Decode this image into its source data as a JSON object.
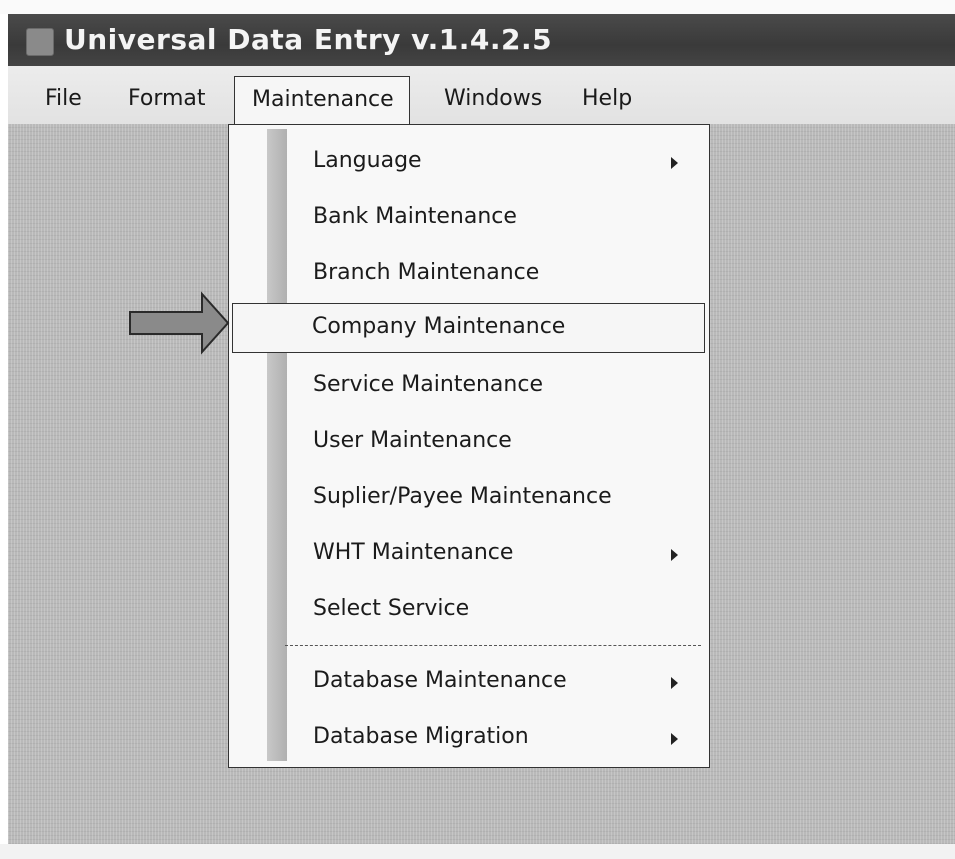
{
  "window": {
    "title": "Universal Data Entry v.1.4.2.5"
  },
  "menubar": {
    "items": [
      {
        "label": "File"
      },
      {
        "label": "Format"
      },
      {
        "label": "Maintenance"
      },
      {
        "label": "Windows"
      },
      {
        "label": "Help"
      }
    ],
    "open_menu": "Maintenance"
  },
  "maintenance_menu": {
    "items": [
      {
        "label": "Language",
        "has_submenu": true
      },
      {
        "label": "Bank Maintenance",
        "has_submenu": false
      },
      {
        "label": "Branch Maintenance",
        "has_submenu": false
      },
      {
        "label": "Company Maintenance",
        "has_submenu": false,
        "highlighted": true
      },
      {
        "label": "Service Maintenance",
        "has_submenu": false
      },
      {
        "label": "User Maintenance",
        "has_submenu": false
      },
      {
        "label": "Suplier/Payee Maintenance",
        "has_submenu": false
      },
      {
        "label": "WHT Maintenance",
        "has_submenu": true
      },
      {
        "label": "Select Service",
        "has_submenu": false
      },
      {
        "label": "Database Maintenance",
        "has_submenu": true
      },
      {
        "label": "Database Migration",
        "has_submenu": true
      }
    ]
  },
  "annotation": {
    "arrow_icon": "right-arrow-icon",
    "points_to": "Company Maintenance"
  },
  "colors": {
    "title_bar": "#3f3f3f",
    "menu_bar": "#e6e6e6",
    "workspace": "#b9b9b9",
    "dropdown_bg": "#f8f8f8",
    "arrow_fill": "#8a8a8a"
  }
}
